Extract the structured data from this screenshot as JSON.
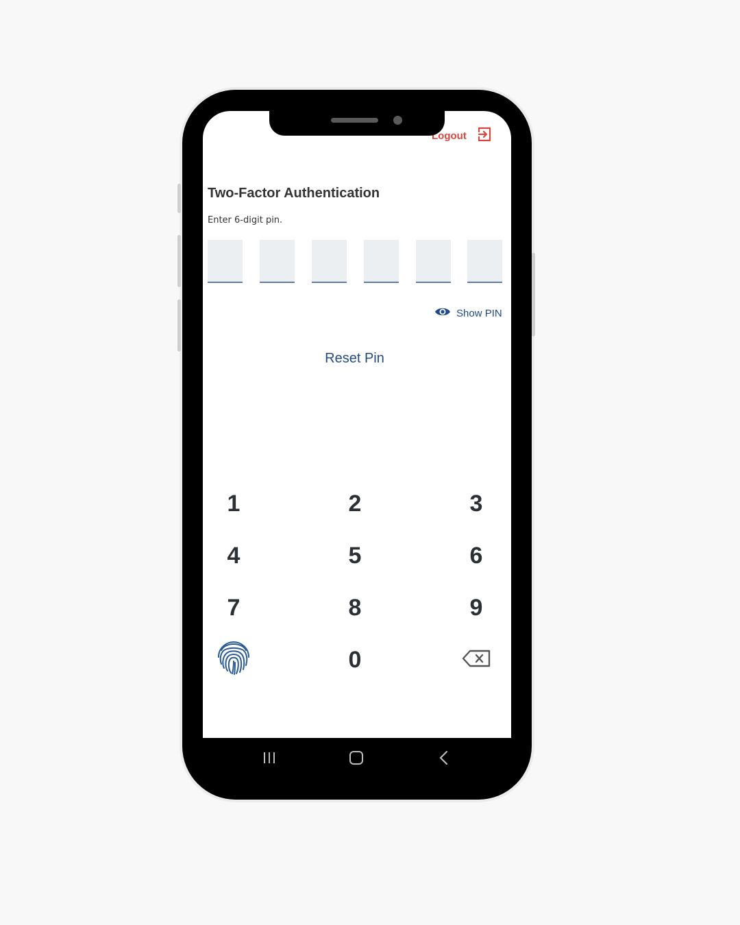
{
  "header": {
    "logout_label": "Logout",
    "logout_icon": "logout-icon",
    "accent_color": "#d9463e"
  },
  "auth": {
    "title": "Two-Factor Authentication",
    "instruction": "Enter 6-digit pin.",
    "pin_boxes": [
      "",
      "",
      "",
      "",
      "",
      ""
    ],
    "show_pin_label": "Show PIN",
    "reset_pin_label": "Reset Pin",
    "link_color": "#234b82"
  },
  "keypad": {
    "keys": [
      "1",
      "2",
      "3",
      "4",
      "5",
      "6",
      "7",
      "8",
      "9",
      "0"
    ],
    "fingerprint_icon": "fingerprint-icon",
    "backspace_icon": "backspace-icon"
  },
  "system_nav": {
    "buttons": [
      "recent-apps-icon",
      "home-icon",
      "back-icon"
    ]
  }
}
